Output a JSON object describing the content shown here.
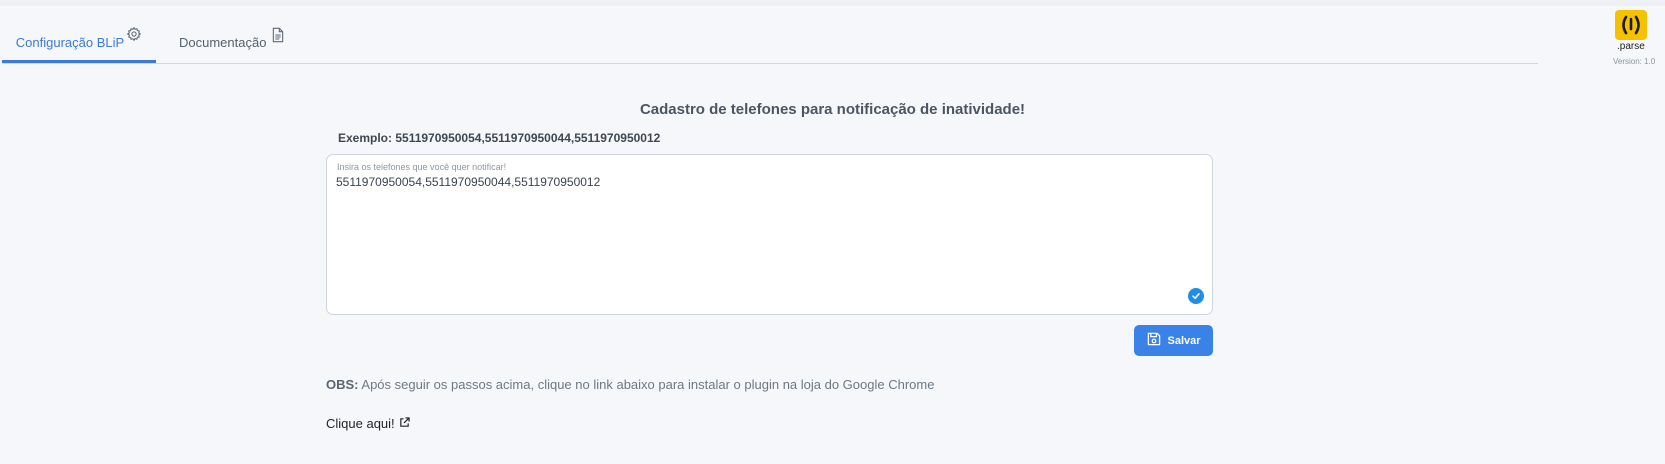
{
  "tabs": [
    {
      "label": "Configuração BLiP",
      "icon": "gear-icon",
      "active": true
    },
    {
      "label": "Documentação",
      "icon": "document-icon",
      "active": false
    }
  ],
  "brand": {
    "name": ".parse",
    "version": "Version: 1.0",
    "color": "#f6c100"
  },
  "main": {
    "title": "Cadastro de telefones para notificação de inatividade!",
    "example": "Exemplo: 5511970950054,5511970950044,5511970950012",
    "field": {
      "label": "Insira os telefones que você quer notificar!",
      "value": "5511970950054,5511970950044,5511970950012"
    },
    "save_label": "Salvar",
    "obs_prefix": "OBS:",
    "obs_text": " Após seguir os passos acima, clique no link abaixo para instalar o plugin na loja do Google Chrome",
    "link_label": "Clique aqui!"
  },
  "colors": {
    "accent": "#3b7ad9",
    "button": "#3b82e8",
    "valid": "#1f8ee8"
  }
}
